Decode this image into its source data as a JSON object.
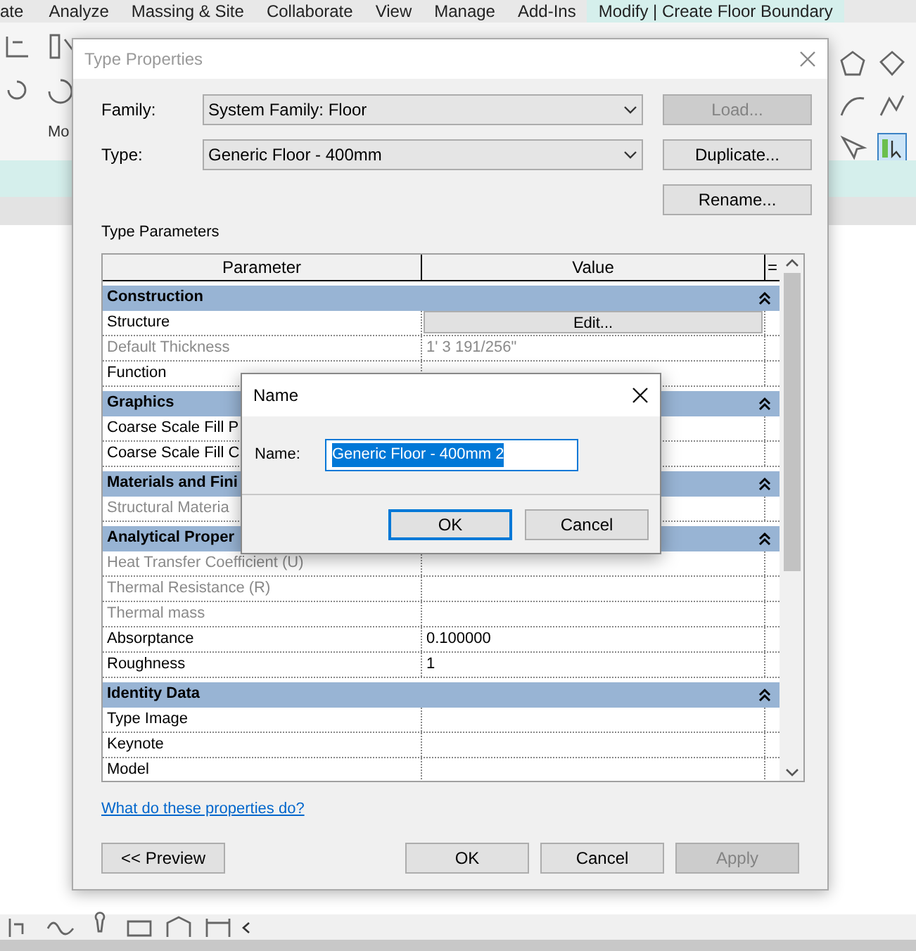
{
  "ribbon_tabs": [
    {
      "label": "ate",
      "selected": false
    },
    {
      "label": "Analyze",
      "selected": false
    },
    {
      "label": "Massing & Site",
      "selected": false
    },
    {
      "label": "Collaborate",
      "selected": false
    },
    {
      "label": "View",
      "selected": false
    },
    {
      "label": "Manage",
      "selected": false
    },
    {
      "label": "Add-Ins",
      "selected": false
    },
    {
      "label": "Modify | Create Floor Boundary",
      "selected": true
    }
  ],
  "ribbon_panel_label": "Mo",
  "dialog": {
    "title": "Type Properties",
    "family": {
      "label": "Family:",
      "value": "System Family: Floor"
    },
    "type": {
      "label": "Type:",
      "value": "Generic Floor - 400mm"
    },
    "side_buttons": [
      {
        "label": "Load...",
        "disabled": true
      },
      {
        "label": "Duplicate...",
        "disabled": false
      },
      {
        "label": "Rename...",
        "disabled": false
      }
    ],
    "section_title": "Type Parameters",
    "table": {
      "columns": [
        "Parameter",
        "Value",
        "="
      ],
      "rows": [
        {
          "kind": "group",
          "label": "Construction",
          "expanded": true
        },
        {
          "kind": "action",
          "label": "Structure",
          "value": "Edit...",
          "disabled": false
        },
        {
          "kind": "param",
          "label": "Default Thickness",
          "value": "1'  3 191/256\"",
          "disabled": true
        },
        {
          "kind": "param",
          "label": "Function",
          "disabled": false
        },
        {
          "kind": "group",
          "label": "Graphics",
          "expanded": true
        },
        {
          "kind": "param",
          "label": "Coarse Scale Fill P",
          "disabled": false
        },
        {
          "kind": "param",
          "label": "Coarse Scale Fill C",
          "disabled": false
        },
        {
          "kind": "group",
          "label": "Materials and Fini",
          "expanded": true
        },
        {
          "kind": "param",
          "label": "Structural Materia",
          "disabled": true
        },
        {
          "kind": "group",
          "label": "Analytical Proper",
          "expanded": true
        },
        {
          "kind": "param",
          "label": "Heat Transfer Coefficient (U)",
          "disabled": true
        },
        {
          "kind": "param",
          "label": "Thermal Resistance (R)",
          "disabled": true
        },
        {
          "kind": "param",
          "label": "Thermal mass",
          "disabled": true
        },
        {
          "kind": "param",
          "label": "Absorptance",
          "value": "0.100000",
          "disabled": false
        },
        {
          "kind": "param",
          "label": "Roughness",
          "value": "1",
          "disabled": false
        },
        {
          "kind": "group",
          "label": "Identity Data",
          "expanded": true
        },
        {
          "kind": "param",
          "label": "Type Image",
          "disabled": false
        },
        {
          "kind": "param",
          "label": "Keynote",
          "disabled": false
        },
        {
          "kind": "param",
          "label": "Model",
          "disabled": false
        }
      ]
    },
    "help_link": "What do these properties do?",
    "preview_button": "<< Preview",
    "buttons": [
      {
        "label": "OK",
        "disabled": false
      },
      {
        "label": "Cancel",
        "disabled": false
      },
      {
        "label": "Apply",
        "disabled": true
      }
    ]
  },
  "name_dialog": {
    "title": "Name",
    "field_label": "Name:",
    "value": "Generic Floor - 400mm 2",
    "value_selected": true,
    "buttons": [
      {
        "label": "OK",
        "default": true
      },
      {
        "label": "Cancel",
        "default": false
      }
    ]
  }
}
